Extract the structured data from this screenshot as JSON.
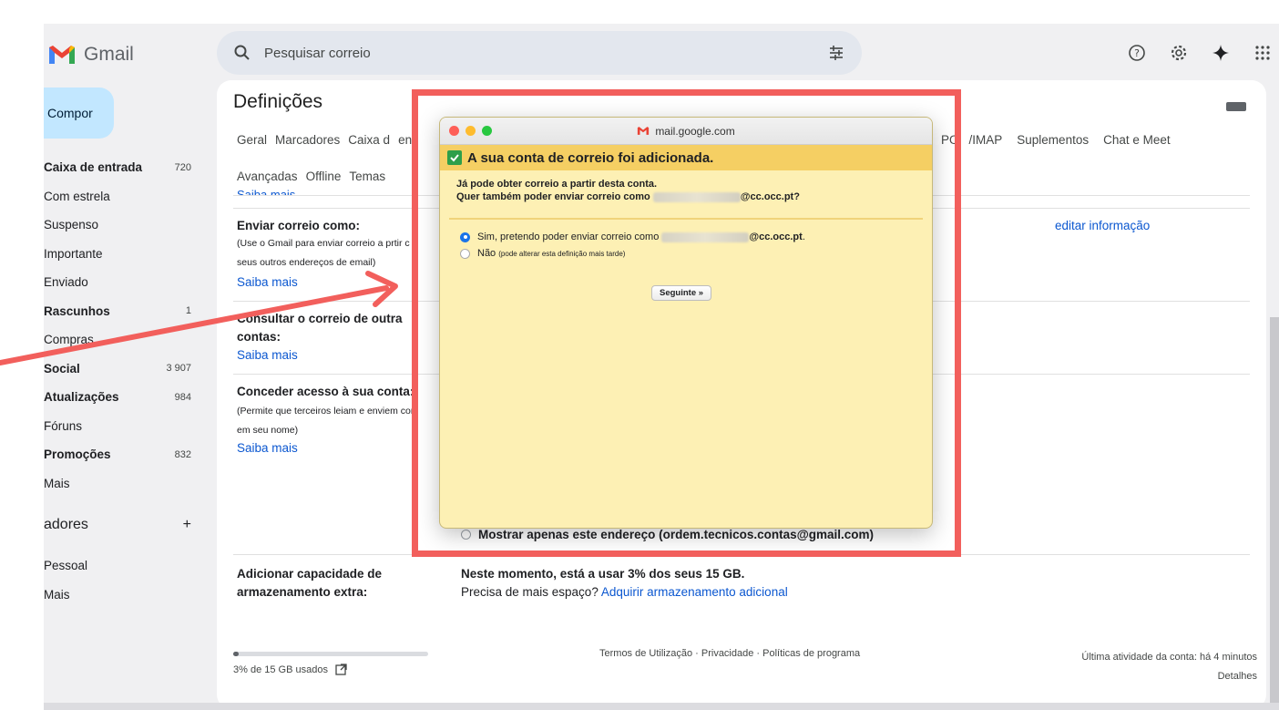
{
  "app": {
    "name": "Gmail"
  },
  "search": {
    "placeholder": "Pesquisar correio"
  },
  "sidebar": {
    "compose": "Compor",
    "items": [
      {
        "label": "Caixa de entrada",
        "count": "720",
        "bold": true
      },
      {
        "label": "Com estrela",
        "count": "",
        "bold": false
      },
      {
        "label": "Suspenso",
        "count": "",
        "bold": false
      },
      {
        "label": "Importante",
        "count": "",
        "bold": false
      },
      {
        "label": "Enviado",
        "count": "",
        "bold": false
      },
      {
        "label": "Rascunhos",
        "count": "1",
        "bold": true
      },
      {
        "label": "Compras",
        "count": "",
        "bold": false
      },
      {
        "label": "Social",
        "count": "3 907",
        "bold": true
      },
      {
        "label": "Atualizações",
        "count": "984",
        "bold": true
      },
      {
        "label": "Fóruns",
        "count": "",
        "bold": false
      },
      {
        "label": "Promoções",
        "count": "832",
        "bold": true
      },
      {
        "label": "Mais",
        "count": "",
        "bold": false
      }
    ],
    "labels_heading": "adores",
    "labels_add": "+",
    "labels": [
      "Pessoal",
      "Mais"
    ]
  },
  "settings": {
    "title": "Definições",
    "tabs_row1": [
      "Geral",
      "Marcadores",
      "Caixa d",
      "en"
    ],
    "tabs_row1_right": [
      "PO",
      "/IMAP",
      "Suplementos",
      "Chat e Meet"
    ],
    "tabs_row2": [
      "Avançadas",
      "Offline",
      "Temas"
    ],
    "cut_link": "Saiba mais",
    "send_as": {
      "title": "Enviar correio como:",
      "desc1": "(Use o Gmail para enviar correio a p",
      "desc1b": "rtir c",
      "desc2": "seus outros endereços de email)",
      "learn_more": "Saiba mais",
      "edit": "editar informação"
    },
    "check_mail": {
      "title1": "Consultar o correio de outra",
      "title2": "contas:",
      "learn_more": "Saiba mais"
    },
    "grant": {
      "title": "Conceder acesso à sua conta:",
      "desc1": "(Permite que terceiros leiam e enviem cor",
      "desc2": "em seu nome)",
      "learn_more": "Saiba mais"
    },
    "show_only": "Mostrar apenas este endereço (ordem.tecnicos.contas@gmail.com)",
    "storage": {
      "title1": "Adicionar capacidade de",
      "title2": "armazenamento extra:",
      "line1": "Neste momento, está a usar 3% dos seus 15 GB.",
      "line2_prefix": "Precisa de mais espaço?",
      "line2_link": "Adquirir armazenamento adicional"
    }
  },
  "footer": {
    "usage": "3% de 15 GB usados",
    "usage_fraction": 0.03,
    "center": "Termos de Utilização · Privacidade · Políticas de programa",
    "activity": "Última atividade da conta: há 4 minutos",
    "details": "Detalhes"
  },
  "dialog": {
    "window_title": "mail.google.com",
    "header": "A sua conta de correio foi adicionada.",
    "line1": "Já pode obter correio a partir desta conta.",
    "line2_prefix": "Quer também poder enviar correio como",
    "line2_suffix": "@cc.occ.pt?",
    "opt_yes_prefix": "Sim, pretendo poder enviar correio como",
    "opt_yes_suffix": "@cc.occ.pt",
    "opt_yes_end": ".",
    "opt_no": "Não",
    "opt_no_small": "(pode alterar esta definição mais tarde)",
    "next_button": "Seguinte »"
  },
  "colors": {
    "highlight": "#f25f5c",
    "dialog_bg": "#fdf0b4",
    "header_bg": "#f5cf63",
    "link": "#0b57d0"
  }
}
